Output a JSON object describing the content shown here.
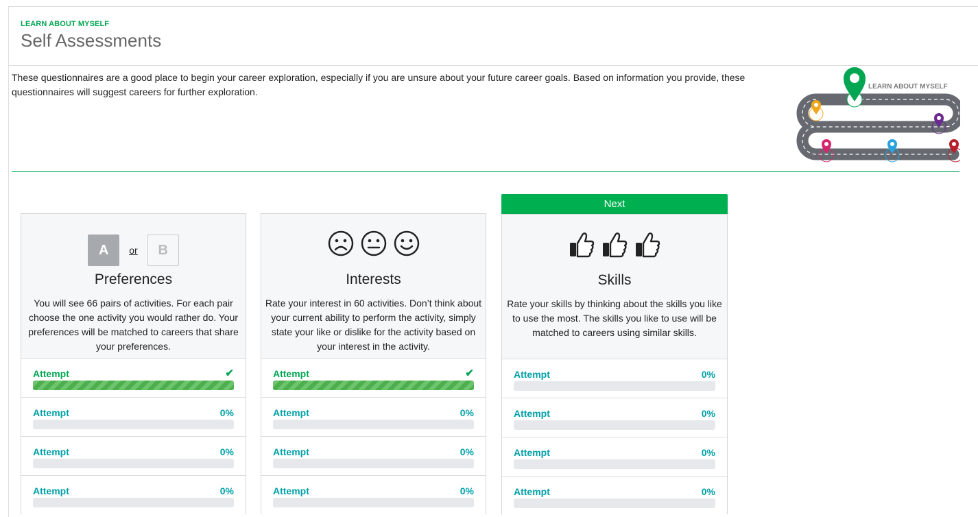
{
  "header": {
    "eyebrow": "LEARN ABOUT MYSELF",
    "title": "Self Assessments"
  },
  "intro": "These questionnaires are a good place to begin your career exploration, especially if you are unsure about your future career goals. Based on information you provide, these questionnaires will suggest careers for further exploration.",
  "roadmap": {
    "label": "LEARN ABOUT MYSELF",
    "colors": {
      "road": "#666a70",
      "current": "#00a651",
      "yellow": "#f2a81d",
      "purple": "#6a2d8f",
      "pink": "#d6246e",
      "blue": "#29a3dd",
      "red": "#b8202b"
    }
  },
  "next_label": "Next",
  "cards": [
    {
      "name": "Preferences",
      "icon": "a-or-b-icon",
      "a": "A",
      "or": "or",
      "b": "B",
      "description": "You will see 66 pairs of activities. For each pair choose the one activity you would rather do. Your preferences will be matched to careers that share your preferences.",
      "attempts": [
        {
          "label": "Attempt",
          "status": "complete",
          "progress": 1.0
        },
        {
          "label": "Attempt",
          "value": "0%",
          "progress": 0
        },
        {
          "label": "Attempt",
          "value": "0%",
          "progress": 0
        },
        {
          "label": "Attempt",
          "value": "0%",
          "progress": 0
        }
      ]
    },
    {
      "name": "Interests",
      "icon": "sad-neutral-happy-faces-icon",
      "description": "Rate your interest in 60 activities. Don’t think about your current ability to perform the activity, simply state your like or dislike for the activity based on your interest in the activity.",
      "attempts": [
        {
          "label": "Attempt",
          "status": "complete",
          "progress": 1.0
        },
        {
          "label": "Attempt",
          "value": "0%",
          "progress": 0
        },
        {
          "label": "Attempt",
          "value": "0%",
          "progress": 0
        },
        {
          "label": "Attempt",
          "value": "0%",
          "progress": 0
        }
      ]
    },
    {
      "name": "Skills",
      "icon": "thumbs-up-icon",
      "description": "Rate your skills by thinking about the skills you like to use the most. The skills you like to use will be matched to careers using similar skills.",
      "attempts": [
        {
          "label": "Attempt",
          "value": "0%",
          "progress": 0
        },
        {
          "label": "Attempt",
          "value": "0%",
          "progress": 0
        },
        {
          "label": "Attempt",
          "value": "0%",
          "progress": 0
        },
        {
          "label": "Attempt",
          "value": "0%",
          "progress": 0
        }
      ]
    }
  ],
  "colors": {
    "accent": "#00a651",
    "next_bg": "#00b050",
    "attempt_text": "#00a0a8"
  }
}
